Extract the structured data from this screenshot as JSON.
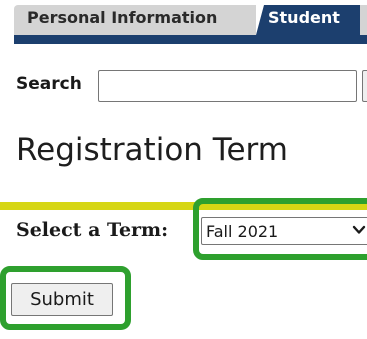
{
  "tabs": [
    {
      "label": "Personal Information",
      "active": false
    },
    {
      "label": "Student",
      "active": true
    }
  ],
  "search": {
    "label": "Search",
    "value": ""
  },
  "page": {
    "title": "Registration Term"
  },
  "term": {
    "label": "Select a Term:",
    "selected": "Fall 2021"
  },
  "submit": {
    "label": "Submit"
  },
  "colors": {
    "tab_active": "#1c3f6e",
    "tab_inactive": "#d4d4d4",
    "title_rule": "#d6d614",
    "highlight": "#2ea02e"
  }
}
